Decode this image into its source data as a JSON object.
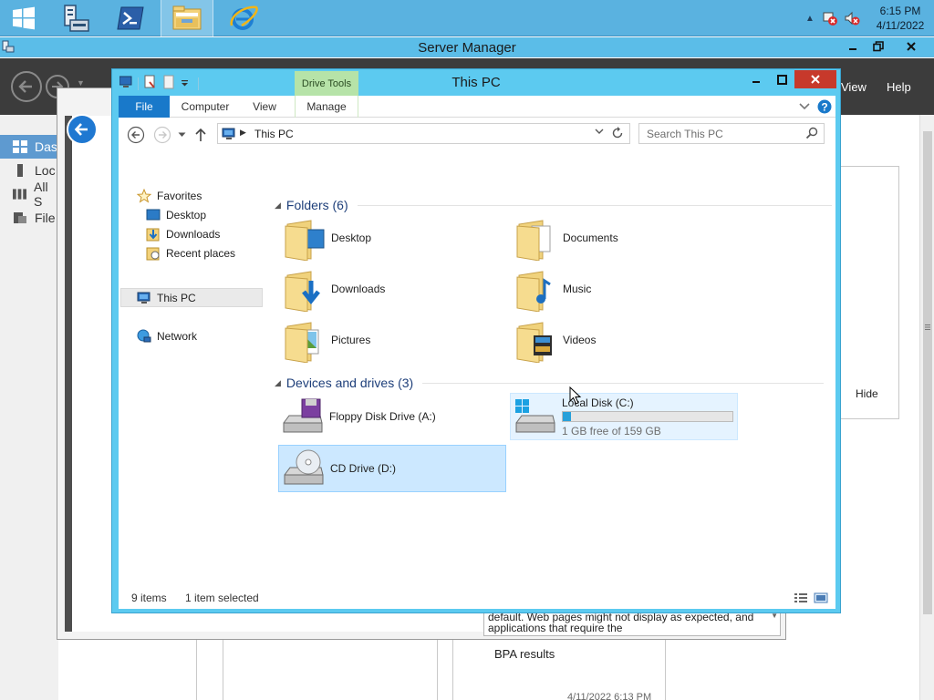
{
  "taskbar": {
    "clock_time": "6:15 PM",
    "clock_date": "4/11/2022",
    "tray_overflow": "▲"
  },
  "server_manager": {
    "title": "Server Manager",
    "menu_view": "View",
    "menu_help": "Help",
    "sidebar": [
      {
        "label": "Das",
        "icon": "dashboard-icon"
      },
      {
        "label": "Loc",
        "icon": "local-server-icon"
      },
      {
        "label": "All S",
        "icon": "all-servers-icon"
      },
      {
        "label": "File",
        "icon": "file-storage-icon"
      }
    ],
    "hide_label": "Hide",
    "bpa_label": "BPA results",
    "timestamp": "4/11/2022 6:13 PM",
    "behind_text": "default. Web pages might not display as expected, and applications that require the"
  },
  "explorer": {
    "title": "This PC",
    "contextual_tab_group": "Drive Tools",
    "ribbon_tabs": {
      "file": "File",
      "computer": "Computer",
      "view": "View",
      "manage": "Manage"
    },
    "address_path": "This PC",
    "search_placeholder": "Search This PC",
    "nav": {
      "favorites": "Favorites",
      "desktop": "Desktop",
      "downloads": "Downloads",
      "recent_places": "Recent places",
      "this_pc": "This PC",
      "network": "Network"
    },
    "folders_header": "Folders (6)",
    "folders": [
      {
        "name": "Desktop"
      },
      {
        "name": "Documents"
      },
      {
        "name": "Downloads"
      },
      {
        "name": "Music"
      },
      {
        "name": "Pictures"
      },
      {
        "name": "Videos"
      }
    ],
    "devices_header": "Devices and drives (3)",
    "drives": {
      "floppy": "Floppy Disk Drive (A:)",
      "local_disk": "Local Disk (C:)",
      "local_disk_free": "1 GB free of 159 GB",
      "local_disk_used_fraction": 0.05,
      "cd": "CD Drive (D:)"
    },
    "status": {
      "items": "9 items",
      "selected": "1 item selected"
    }
  }
}
